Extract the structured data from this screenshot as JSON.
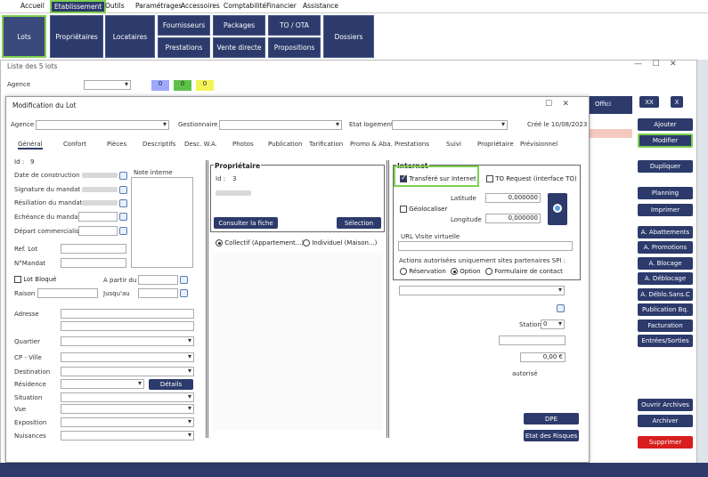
{
  "menu": [
    "Accueil",
    "Etablissement",
    "Outils",
    "Paramétrages",
    "Accessoires",
    "Comptabilité",
    "Financier",
    "Assistance"
  ],
  "nav": {
    "lots": "Lots",
    "proprietaires": "Propriétaires",
    "locataires": "Locataires",
    "fournisseurs": "Fournisseurs",
    "prestations": "Prestations",
    "packages": "Packages",
    "vente_directe": "Vente directe",
    "to_ota": "TO / OTA",
    "propositions": "Propositions",
    "dossiers": "Dossiers"
  },
  "list_window": {
    "title": "Liste des 5 lots",
    "agence_label": "Agence",
    "badge1": "0",
    "badge2": "0",
    "badge3": "0",
    "xx": "XX",
    "x": "X",
    "offici": "Offici"
  },
  "right_buttons": {
    "ajouter": "Ajouter",
    "modifier": "Modifier",
    "dupliquer": "Dupliquer",
    "planning": "Planning",
    "imprimer": "Imprimer",
    "abattements": "A. Abattements",
    "promotions": "A. Promotions",
    "blocage": "A. Blocage",
    "deblocage": "A. Déblocage",
    "deblo_sans": "A. Déblo.Sans.C",
    "publication": "Publication Bq.",
    "facturation": "Facturation",
    "entrees": "Entrées/Sorties",
    "ouvrir": "Ouvrir Archives",
    "archiver": "Archiver",
    "supprimer": "Supprimer"
  },
  "modal": {
    "title": "Modification du Lot",
    "agence": "Agence",
    "gestionnaire": "Gestionnaire",
    "etat_logement": "Etat logement",
    "cree": "Créé le 10/08/2023",
    "tabs": [
      "Général",
      "Confort",
      "Pièces",
      "Descriptifs",
      "Desc. W.A.",
      "Photos",
      "Publication",
      "Tarification",
      "Promo & Aba.",
      "Prestations",
      "Suivi",
      "Propriétaire",
      "Prévisionnel"
    ],
    "id_label": "Id :",
    "id_value": "9",
    "note_interne": "Note interne",
    "left_fields": [
      "Date de construction",
      "Signature du mandat",
      "Résiliation du mandat",
      "Echéance du mandat",
      "Départ commercialis.",
      "Ref. Lot",
      "N°Mandat"
    ],
    "lot_bloque": "Lot Bloqué",
    "a_partir_du": "A partir du",
    "raison": "Raison",
    "jusquau": "Jusqu'au",
    "adresse": "Adresse",
    "quartier": "Quartier",
    "cp_ville": "CP - Ville",
    "destination": "Destination",
    "residence": "Résidence",
    "details": "Détails",
    "situation": "Situation",
    "vue": "Vue",
    "exposition": "Exposition",
    "nuisances": "Nuisances",
    "proprietaire_title": "Propriétaire",
    "prop_id_label": "Id :",
    "prop_id": "3",
    "consulter": "Consulter la fiche",
    "selection": "Sélection",
    "collectif": "Collectif (Appartement...)",
    "individuel": "Individuel (Maison...)",
    "internet_title": "Internet",
    "transfere": "Transféré sur Internet",
    "to_request": "TO Request (interface TO)",
    "geolocaliser": "Géolocaliser",
    "latitude": "Latitude",
    "latitude_val": "0,000000",
    "longitude": "Longitude",
    "longitude_val": "0,000000",
    "url_visite": "URL Visite virtuelle",
    "actions": "Actions autorisées uniquement sites partenaires SPI :",
    "reservation": "Réservation",
    "option": "Option",
    "formulaire": "Formulaire de contact",
    "station": "Station",
    "station_val": "0",
    "amount": "0,00 €",
    "autorise": "autorisé",
    "dpe": "DPE",
    "etat_risques": "Etat des Risques"
  }
}
